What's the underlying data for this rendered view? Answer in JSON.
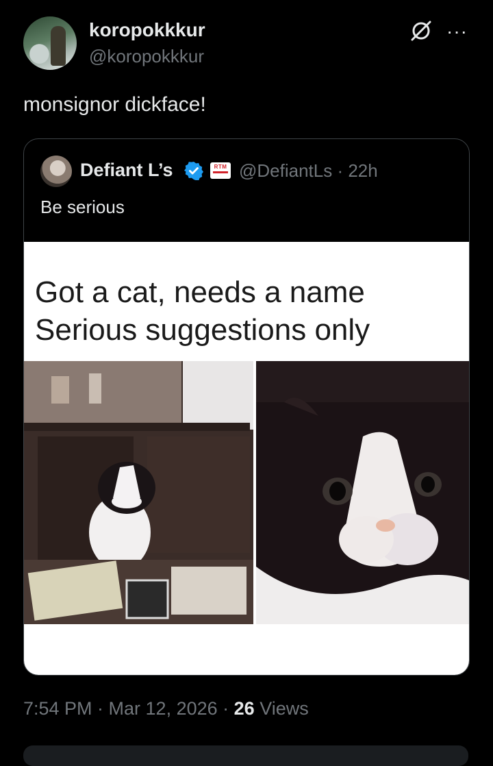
{
  "author": {
    "display_name": "koropokkkur",
    "handle": "@koropokkkur"
  },
  "tweet": {
    "text": "monsignor dickface!"
  },
  "quoted": {
    "display_name": "Defiant L’s",
    "handle_time": "@DefiantLs · 22h",
    "text": "Be serious",
    "badge_label": "RTM",
    "meme_caption_line1": "Got a cat, needs a name",
    "meme_caption_line2": "Serious suggestions only"
  },
  "meta": {
    "time_date": "7:54 PM · Mar 12, 2026 · ",
    "views_count": "26",
    "views_label": " Views"
  },
  "icons": {
    "grok": "grok-icon",
    "more": "more-icon",
    "verified": "verified-badge-icon",
    "verified_color": "#1d9bf0"
  }
}
